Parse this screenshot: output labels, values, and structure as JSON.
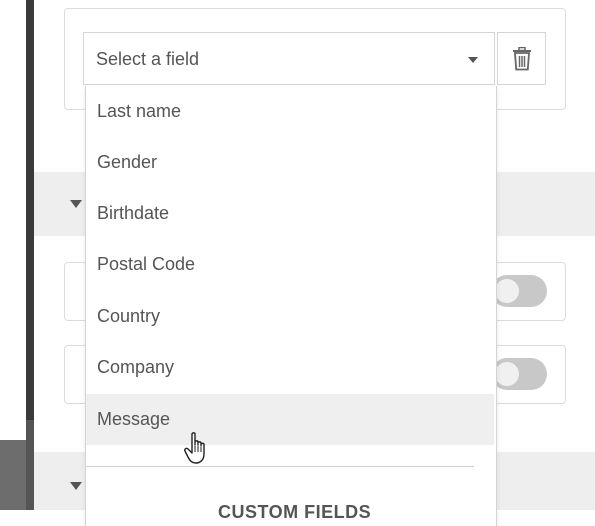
{
  "field_selector": {
    "placeholder": "Select a field",
    "delete_icon": "trash-icon"
  },
  "dropdown": {
    "items": [
      "Last name",
      "Gender",
      "Birthdate",
      "Postal Code",
      "Country",
      "Company",
      "Message"
    ],
    "hovered_item": "Message",
    "section_title": "CUSTOM FIELDS"
  },
  "sections": {
    "collapse_icon": "caret-down-icon"
  },
  "toggles": [
    {
      "state": "off"
    },
    {
      "state": "off"
    }
  ]
}
